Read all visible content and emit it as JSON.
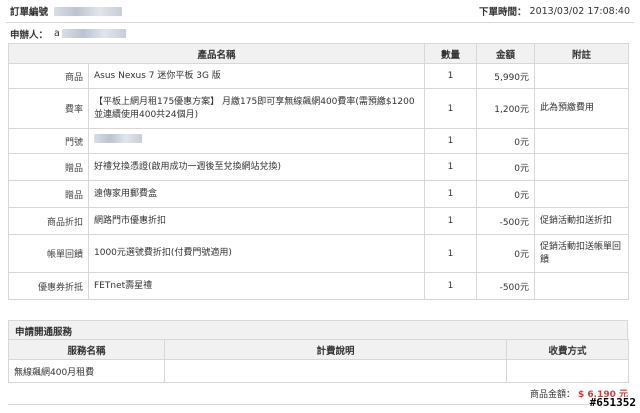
{
  "order": {
    "number_label": "訂單編號",
    "date_label": "下單時間：",
    "date_value": "2013/03/02 17:08:40",
    "buyer_label": "申辦人：",
    "buyer_partial": "a"
  },
  "items_table": {
    "headers": [
      "產品名稱",
      "數量",
      "金額",
      "附註"
    ],
    "rows": [
      {
        "category": "商品",
        "product": "Asus Nexus 7 迷你平板 3G 版",
        "qty": "1",
        "amount": "5,990元",
        "note": ""
      },
      {
        "category": "費率",
        "product": "【平板上網月租175優惠方案】 月繳175即可享無線飆網400費率(需預繳$1200並連續使用400共24個月)",
        "qty": "1",
        "amount": "1,200元",
        "note": "此為預繳費用"
      },
      {
        "category": "門號",
        "product": "",
        "qty": "1",
        "amount": "0元",
        "note": ""
      },
      {
        "category": "贈品",
        "product": "好禮兌換憑證(啟用成功一週後至兌換網站兌換)",
        "qty": "1",
        "amount": "0元",
        "note": ""
      },
      {
        "category": "贈品",
        "product": "遠傳家用郵費盒",
        "qty": "1",
        "amount": "0元",
        "note": ""
      },
      {
        "category": "商品折扣",
        "product": "網路門市優惠折扣",
        "qty": "1",
        "amount": "-500元",
        "note": "促銷活動扣送折扣"
      },
      {
        "category": "帳單回饋",
        "product": "1000元選號費折扣(付費門號適用)",
        "qty": "1",
        "amount": "0元",
        "note": "促銷活動扣送帳單回饋"
      },
      {
        "category": "優惠券折抵",
        "product": "FETnet壽星禮",
        "qty": "1",
        "amount": "-500元",
        "note": ""
      }
    ]
  },
  "services": {
    "title": "申請開通服務",
    "headers": [
      "服務名稱",
      "計費說明",
      "收費方式"
    ],
    "rows": [
      {
        "name": "無線飆網400月租費",
        "billing": "",
        "payment": ""
      }
    ]
  },
  "totals": {
    "label": "商品金額：",
    "value": "$ 6,190 元"
  },
  "watermark": "#651352"
}
